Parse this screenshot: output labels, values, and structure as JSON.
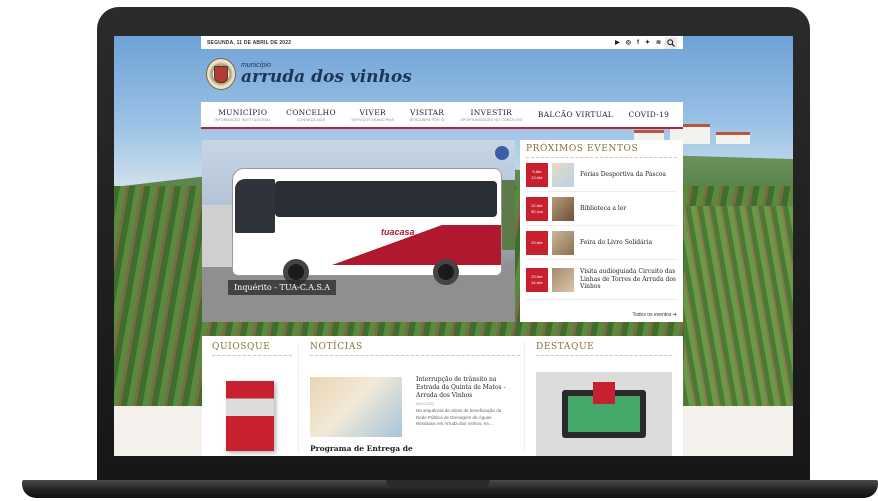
{
  "topbar": {
    "date": "SEGUNDA, 11 DE ABRIL DE 2022",
    "social_icons": [
      "youtube-icon",
      "instagram-icon",
      "facebook-icon",
      "twitter-icon",
      "rss-icon"
    ],
    "search_icon": "search-icon"
  },
  "logo": {
    "small": "município",
    "big": "arruda dos vinhos"
  },
  "nav": {
    "items": [
      {
        "label": "MUNICÍPIO",
        "sub": "INFORMAÇÃO INSTITUCIONAL"
      },
      {
        "label": "CONCELHO",
        "sub": "CONHEÇA-NOS"
      },
      {
        "label": "VIVER",
        "sub": "SERVIÇOS MUNICIPAIS"
      },
      {
        "label": "VISITAR",
        "sub": "DESCUBRA POR SI"
      },
      {
        "label": "INVESTIR",
        "sub": "OPORTUNIDADES NO CONCELHO"
      },
      {
        "label": "BALCÃO VIRTUAL",
        "sub": ""
      },
      {
        "label": "COVID-19",
        "sub": ""
      }
    ]
  },
  "hero": {
    "caption": "Inquérito - TUA-C.A.S.A",
    "bus_logo": "tuacasa"
  },
  "events": {
    "title": "PRÓXIMOS EVENTOS",
    "items": [
      {
        "date_line1": "5 Abr",
        "date_line2": "13 Abr",
        "title": "Férias Desportiva da Páscoa"
      },
      {
        "date_line1": "22 Abr",
        "date_line2": "30 Jun",
        "title": "Biblioteca a ler"
      },
      {
        "date_line1": "23 Abr",
        "date_line2": "",
        "title": "Feira do Livro Solidária"
      },
      {
        "date_line1": "23 Abr",
        "date_line2": "24 Abr",
        "title": "Visita audioguiada Circuito das Linhas de Torres de Arruda dos Vinhos"
      }
    ],
    "all_link": "Todos os eventos"
  },
  "quiosque": {
    "title": "QUIOSQUE"
  },
  "noticias": {
    "title": "NOTÍCIAS",
    "items": [
      {
        "title": "Interrupção de trânsito na Estrada da Quinta de Matos - Arruda dos Vinhos",
        "date": "08-04-2022",
        "desc": "Na sequência de obras de beneficiação da Rede Pública de Drenagem de Águas Residuais em Arruda dos Vinhos, ea ..."
      }
    ],
    "bottom_title": "Programa de Entrega de"
  },
  "destaque": {
    "title": "DESTAQUE"
  }
}
